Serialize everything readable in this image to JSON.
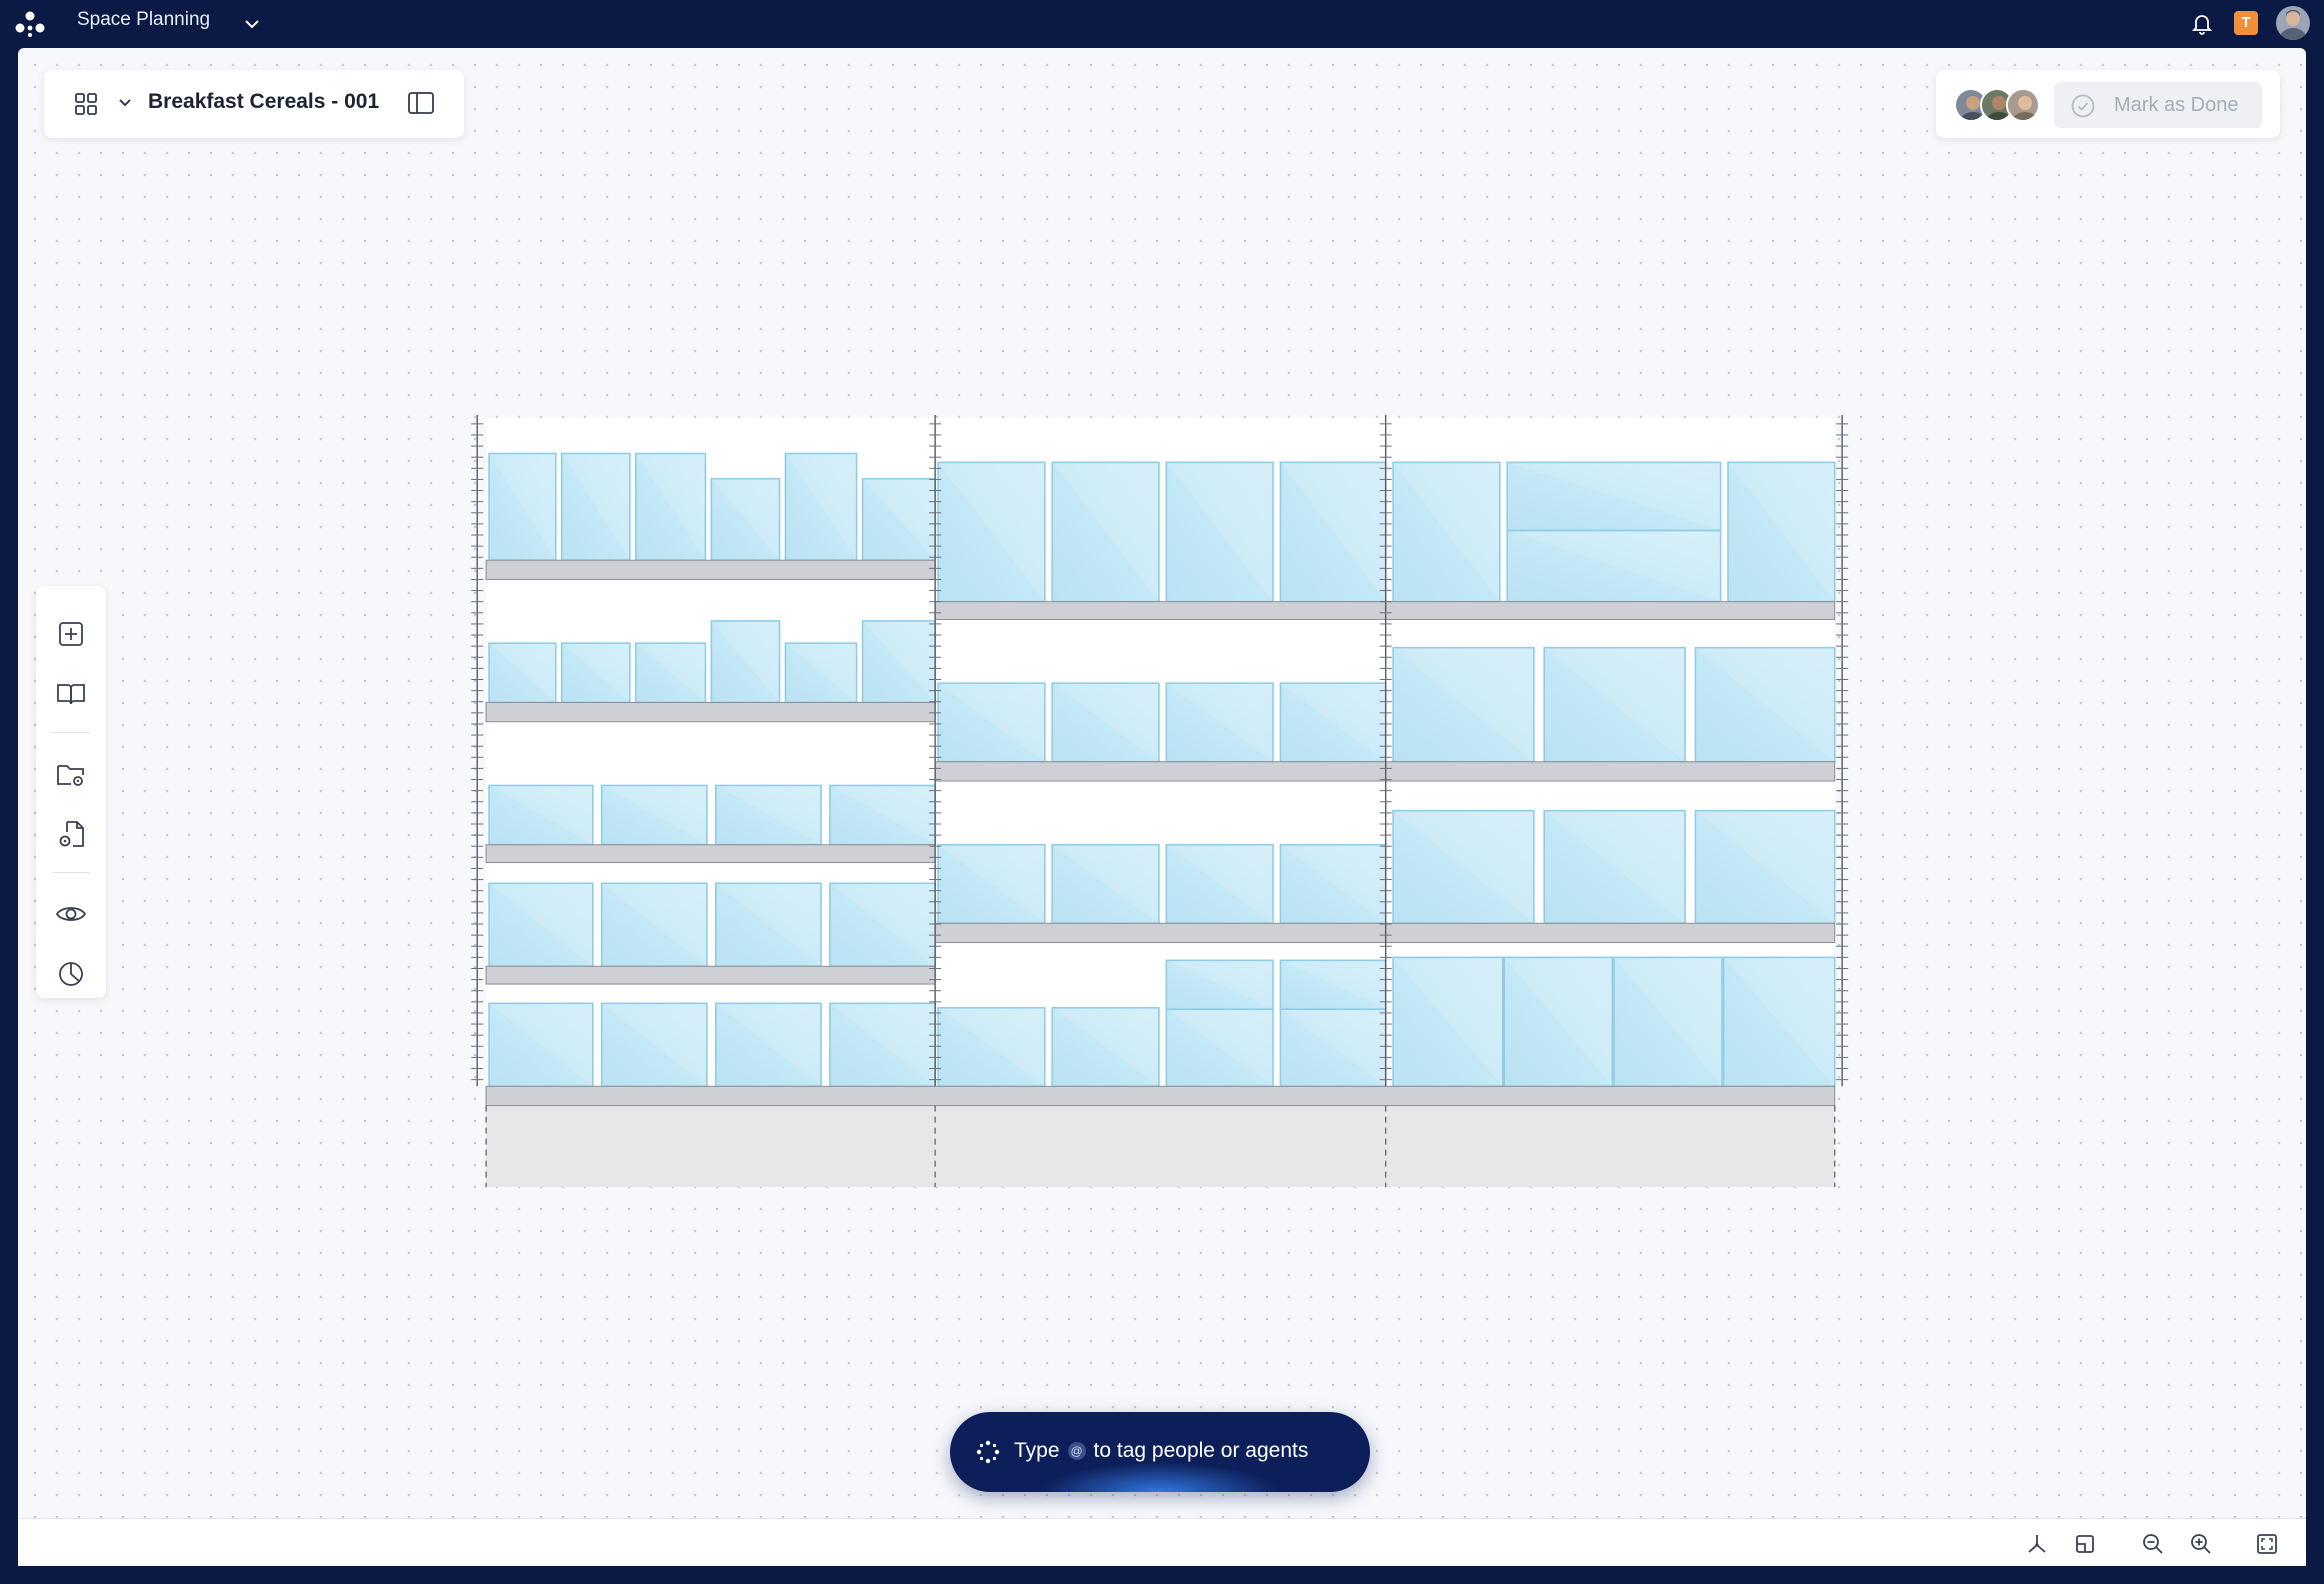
{
  "app": {
    "title": "Space Planning"
  },
  "header": {
    "badge_letter": "T"
  },
  "document": {
    "title": "Breakfast Cereals - 001"
  },
  "actions": {
    "mark_done_label": "Mark as Done"
  },
  "left_toolbar": {
    "tools": [
      "add-icon",
      "catalog-book-icon",
      "folder-settings-icon",
      "file-settings-icon",
      "eye-icon",
      "pie-chart-icon"
    ]
  },
  "chat": {
    "prefix": "Type",
    "at_symbol": "@",
    "suffix": "to tag people or agents"
  },
  "bottom_toolbar": {
    "tools": [
      "axes-icon",
      "floorplan-icon",
      "zoom-out-icon",
      "zoom-in-icon",
      "fit-screen-icon"
    ]
  },
  "colors": {
    "topbar": "#0b1a45",
    "product_fill": "#bfe6f5",
    "product_stroke": "#8fcde6",
    "shelf": "#cfd0d5",
    "accent": "#f0913a"
  }
}
